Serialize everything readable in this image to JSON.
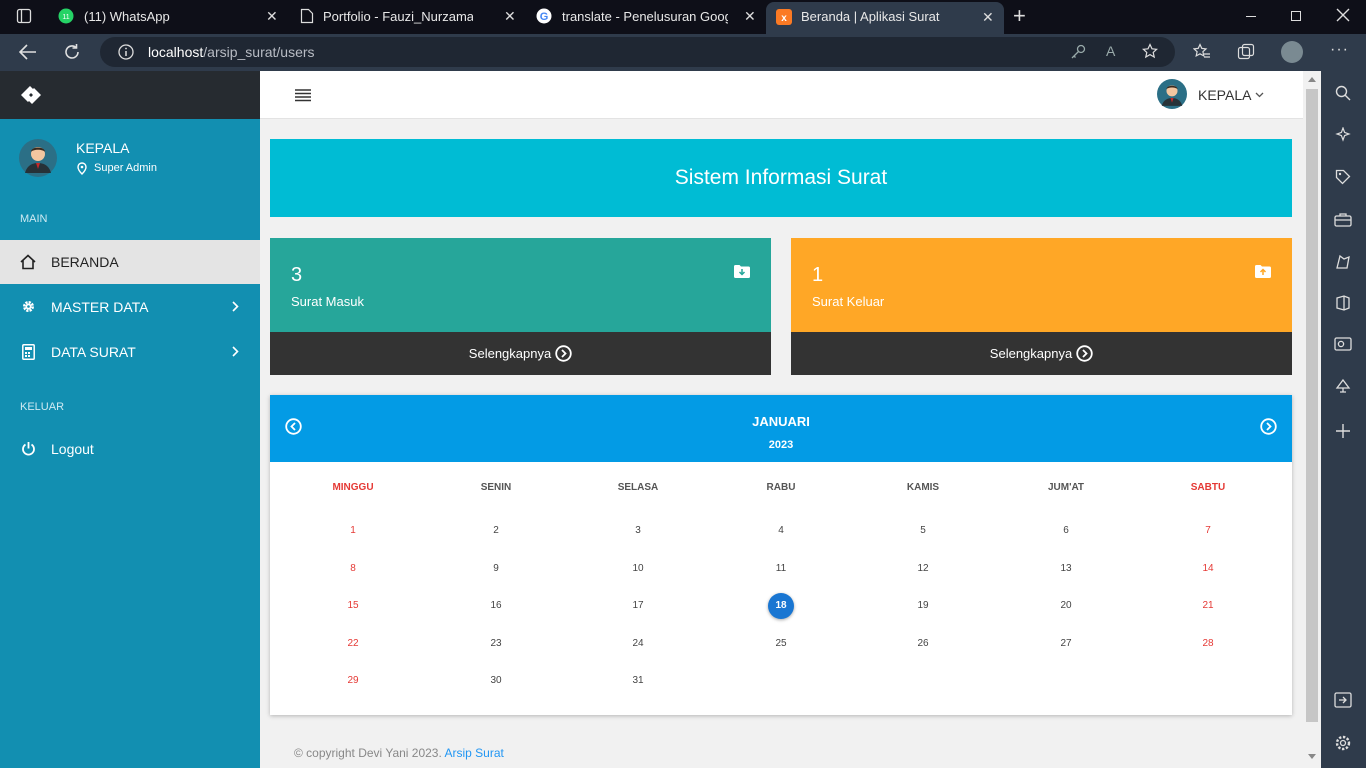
{
  "browser": {
    "tabs": [
      {
        "title": "(11) WhatsApp"
      },
      {
        "title": "Portfolio - Fauzi_Nurzaman"
      },
      {
        "title": "translate - Penelusuran Google"
      },
      {
        "title": "Beranda | Aplikasi Surat"
      }
    ],
    "close_glyph": "✕",
    "new_tab_glyph": "+",
    "url_host": "localhost",
    "url_path": "/arsip_surat/users"
  },
  "sidebar": {
    "user_name": "KEPALA",
    "user_role": "Super Admin",
    "section_main": "MAIN",
    "section_keluar": "KELUAR",
    "items": [
      {
        "label": "BERANDA",
        "icon": "home-icon"
      },
      {
        "label": "MASTER DATA",
        "icon": "gear-icon"
      },
      {
        "label": "DATA SURAT",
        "icon": "calculator-icon"
      }
    ],
    "logout_label": "Logout"
  },
  "topbar": {
    "user_label": "KEPALA"
  },
  "banner": {
    "title": "Sistem Informasi Surat"
  },
  "cards": [
    {
      "count": "3",
      "label": "Surat Masuk",
      "more": "Selengkapnya",
      "color": "#26a69a",
      "icon": "folder-download-icon"
    },
    {
      "count": "1",
      "label": "Surat Keluar",
      "more": "Selengkapnya",
      "color": "#ffa726",
      "icon": "folder-upload-icon"
    }
  ],
  "calendar": {
    "month": "JANUARI",
    "year": "2023",
    "days_of_week": [
      "MINGGU",
      "SENIN",
      "SELASA",
      "RABU",
      "KAMIS",
      "JUM'AT",
      "SABTU"
    ],
    "weeks": [
      [
        "1",
        "2",
        "3",
        "4",
        "5",
        "6",
        "7"
      ],
      [
        "8",
        "9",
        "10",
        "11",
        "12",
        "13",
        "14"
      ],
      [
        "15",
        "16",
        "17",
        "18",
        "19",
        "20",
        "21"
      ],
      [
        "22",
        "23",
        "24",
        "25",
        "26",
        "27",
        "28"
      ],
      [
        "29",
        "30",
        "31",
        "",
        "",
        "",
        ""
      ]
    ],
    "today": "18"
  },
  "footer": {
    "text": "© copyright Devi Yani 2023.",
    "link": "Arsip Surat"
  },
  "colors": {
    "sidebar": "#128fb1",
    "banner": "#00bcd4",
    "calendar_header": "#039be5",
    "weekend": "#e53935"
  }
}
